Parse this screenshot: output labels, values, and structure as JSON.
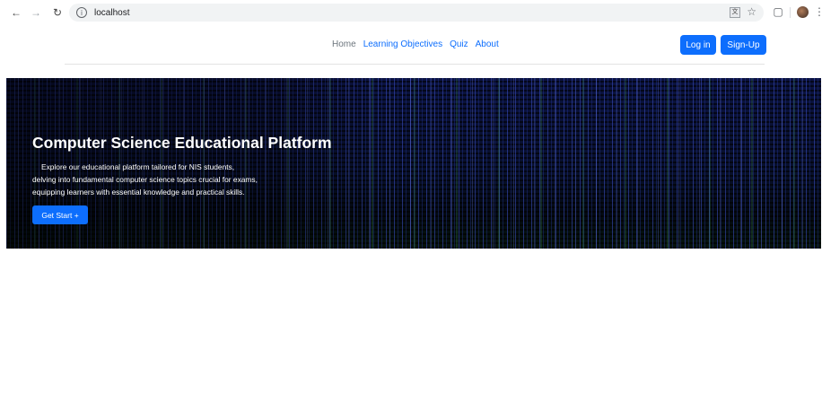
{
  "browser": {
    "url": "localhost",
    "back_icon": "arrow-left-icon",
    "forward_icon": "arrow-right-icon",
    "reload_icon": "reload-icon"
  },
  "nav": {
    "links": [
      {
        "label": "Home"
      },
      {
        "label": "Learning Objectives"
      },
      {
        "label": "Quiz"
      },
      {
        "label": "About"
      }
    ],
    "login_label": "Log in",
    "signup_label": "Sign-Up"
  },
  "hero": {
    "title": "Computer Science Educational Platform",
    "description_lines": [
      "Explore our educational platform tailored for NIS students,",
      "delving into fundamental computer science topics crucial for exams,",
      "equipping learners with essential knowledge and practical skills."
    ],
    "cta_label": "Get Start +"
  },
  "colors": {
    "primary": "#0d6efd",
    "nav_muted": "#6c757d",
    "hero_bg": "#04060f"
  }
}
